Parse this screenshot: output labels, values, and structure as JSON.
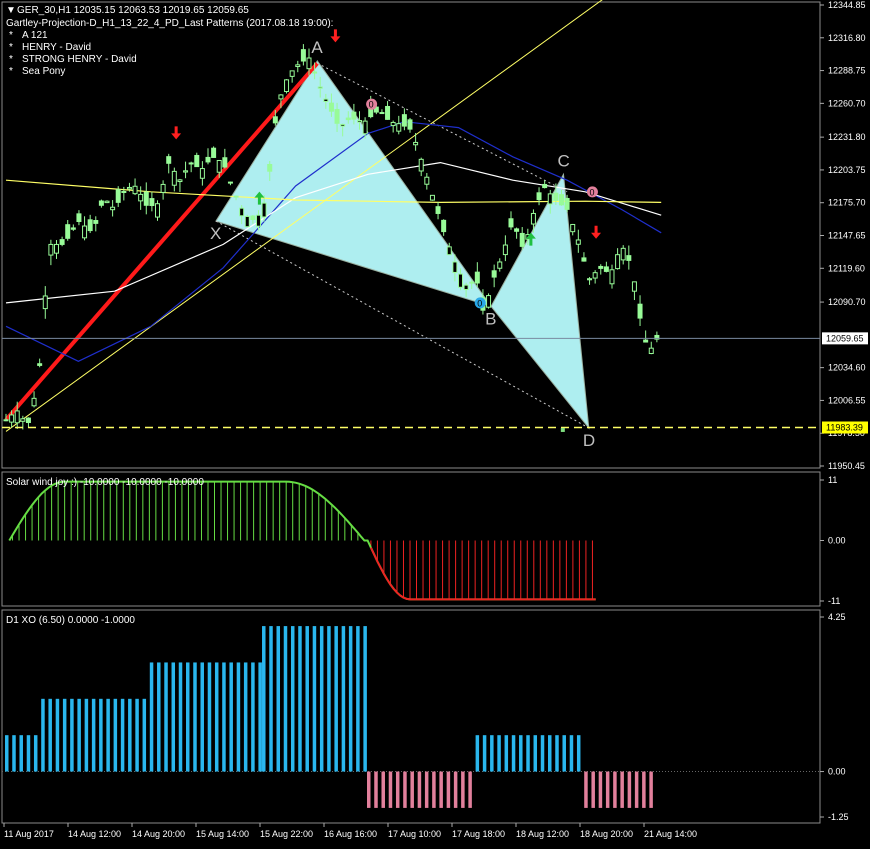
{
  "header": {
    "symbol_line": "GER_30,H1  12035.15 12063.53 12019.65 12059.65",
    "pattern_title": "Gartley-Projection-D_H1_13_22_4_PD_Last Patterns (2017.08.18 19:00):",
    "patterns": [
      "A 121",
      "HENRY - David",
      "STRONG HENRY - David",
      "Sea Pony"
    ],
    "bullet": "*"
  },
  "colors": {
    "background": "#000000",
    "grid": "#3a3a3a",
    "bull_candle": "#98fb98",
    "pattern_fill": "#aeeef0",
    "trend_line": "#ff1a1a",
    "ma_blue": "#1f2fcc",
    "ma_white": "#ffffff",
    "ma_yellow": "#ffff66",
    "solar_positive": "#66dd44",
    "solar_negative": "#ee2222",
    "xo_positive": "#2ab7ee",
    "xo_negative": "#e2809c",
    "current_price_tag": "#ffffff",
    "projection_tag": "#ffff00"
  },
  "chart_data": [
    {
      "type": "candlestick",
      "panel": "main",
      "symbol": "GER_30",
      "timeframe": "H1",
      "ylim": [
        11950.45,
        12344.85
      ],
      "y_ticks": [
        "12344.85",
        "12316.80",
        "12288.75",
        "12260.70",
        "12231.80",
        "12203.75",
        "12175.70",
        "12147.65",
        "12119.60",
        "12090.70",
        "12034.60",
        "12006.55",
        "11978.50",
        "11950.45"
      ],
      "current_price": "12059.65",
      "projection_level": "11983.39",
      "bar_count": 117,
      "close_path": [
        [
          0,
          11990
        ],
        [
          3,
          11998
        ],
        [
          6,
          11985
        ],
        [
          9,
          12025
        ],
        [
          12,
          12140
        ],
        [
          16,
          12140
        ],
        [
          20,
          12160
        ],
        [
          24,
          12150
        ],
        [
          27,
          12180
        ],
        [
          30,
          12170
        ],
        [
          33,
          12188
        ],
        [
          36,
          12190
        ],
        [
          39,
          12172
        ],
        [
          42,
          12175
        ],
        [
          45,
          12210
        ],
        [
          48,
          12195
        ],
        [
          51,
          12210
        ],
        [
          54,
          12204
        ],
        [
          57,
          12215
        ],
        [
          60,
          12210
        ],
        [
          63,
          12185
        ],
        [
          66,
          12165
        ],
        [
          69,
          12160
        ],
        [
          72,
          12180
        ],
        [
          75,
          12260
        ],
        [
          78,
          12285
        ],
        [
          81,
          12295
        ],
        [
          84,
          12300
        ],
        [
          86,
          12280
        ],
        [
          89,
          12260
        ],
        [
          92,
          12240
        ],
        [
          95,
          12248
        ],
        [
          99,
          12245
        ],
        [
          103,
          12255
        ],
        [
          106,
          12245
        ],
        [
          109,
          12243
        ],
        [
          112,
          12238
        ],
        [
          115,
          12210
        ],
        [
          118,
          12180
        ],
        [
          121,
          12150
        ],
        [
          124,
          12125
        ],
        [
          127,
          12105
        ],
        [
          130,
          12110
        ],
        [
          132,
          12080
        ],
        [
          134,
          12105
        ],
        [
          137,
          12130
        ],
        [
          140,
          12160
        ],
        [
          143,
          12135
        ],
        [
          146,
          12170
        ],
        [
          149,
          12190
        ],
        [
          151,
          12180
        ],
        [
          153,
          12175
        ],
        [
          155,
          12170
        ],
        [
          158,
          12145
        ],
        [
          161,
          12110
        ],
        [
          164,
          12120
        ],
        [
          167,
          12115
        ],
        [
          170,
          12140
        ],
        [
          173,
          12120
        ],
        [
          176,
          12060
        ],
        [
          178,
          12050
        ],
        [
          181,
          12065
        ]
      ],
      "moving_averages": [
        {
          "color": "#1f2fcc",
          "path": [
            [
              0,
              12070
            ],
            [
              20,
              12040
            ],
            [
              40,
              12070
            ],
            [
              60,
              12120
            ],
            [
              80,
              12190
            ],
            [
              100,
              12235
            ],
            [
              110,
              12245
            ],
            [
              125,
              12240
            ],
            [
              140,
              12215
            ],
            [
              155,
              12195
            ],
            [
              170,
              12170
            ],
            [
              181,
              12150
            ]
          ]
        },
        {
          "color": "#ffffff",
          "path": [
            [
              0,
              12090
            ],
            [
              30,
              12100
            ],
            [
              60,
              12140
            ],
            [
              80,
              12180
            ],
            [
              100,
              12200
            ],
            [
              120,
              12210
            ],
            [
              140,
              12195
            ],
            [
              160,
              12185
            ],
            [
              181,
              12165
            ]
          ]
        },
        {
          "color": "#ffff66",
          "path": [
            [
              0,
              12195
            ],
            [
              40,
              12185
            ],
            [
              80,
              12178
            ],
            [
              120,
              12176
            ],
            [
              160,
              12177
            ],
            [
              181,
              12176
            ]
          ]
        }
      ],
      "trend_lines": [
        {
          "style": "solid-red",
          "from": [
            0,
            11990
          ],
          "to": [
            86,
            12295
          ]
        },
        {
          "style": "solid-yellow",
          "from": [
            0,
            11980
          ],
          "to": [
            165,
            12350
          ]
        },
        {
          "style": "dotted-white",
          "from": [
            58,
            12160
          ],
          "to": [
            161,
            11983
          ]
        },
        {
          "style": "dotted-white",
          "from": [
            86,
            12295
          ],
          "to": [
            155,
            12185
          ]
        }
      ],
      "harmonic_pattern": {
        "points": [
          {
            "label": "X",
            "bar": 58,
            "price": 12160
          },
          {
            "label": "A",
            "bar": 86,
            "price": 12297
          },
          {
            "label": "B",
            "bar": 134,
            "price": 12087
          },
          {
            "label": "C",
            "bar": 154,
            "price": 12200
          },
          {
            "label": "D",
            "bar": 161,
            "price": 11983
          }
        ]
      },
      "signal_arrows": [
        {
          "dir": "down",
          "color": "red",
          "bar": 47,
          "price": 12235
        },
        {
          "dir": "up",
          "color": "green",
          "bar": 70,
          "price": 12180
        },
        {
          "dir": "down",
          "color": "red",
          "bar": 91,
          "price": 12318
        },
        {
          "dir": "up",
          "color": "green",
          "bar": 145,
          "price": 12145
        },
        {
          "dir": "down",
          "color": "red",
          "bar": 163,
          "price": 12150
        }
      ],
      "zero_markers": [
        {
          "bar": 101,
          "price": 12260,
          "color": "pink"
        },
        {
          "bar": 131,
          "price": 12090,
          "color": "cyan"
        },
        {
          "bar": 162,
          "price": 12185,
          "color": "pink"
        }
      ]
    },
    {
      "type": "histogram",
      "panel": "Solar wind joy",
      "title": "Solar wind joy :) -10.0000 -10.0000 -10.0000",
      "ylim": [
        -11,
        11
      ],
      "y_ticks": [
        "11",
        "0.00",
        "-11"
      ],
      "bars": [
        {
          "from": 1,
          "to": 18,
          "shape": "rise",
          "start": 0,
          "end": 10.7
        },
        {
          "from": 19,
          "to": 85,
          "shape": "flat",
          "value": 10.7
        },
        {
          "from": 86,
          "to": 110,
          "shape": "fall_pos",
          "start": 10.7,
          "end": 0
        },
        {
          "from": 111,
          "to": 124,
          "shape": "fall_neg",
          "start": 0,
          "end": -10.7
        },
        {
          "from": 125,
          "to": 181,
          "shape": "flat",
          "value": -10.7
        }
      ]
    },
    {
      "type": "bar",
      "panel": "D1 XO",
      "title": "D1 XO (6.50) 0.0000 -1.0000",
      "ylim": [
        -1.25,
        4.25
      ],
      "y_ticks": [
        "4.25",
        "0.00",
        "-1.25"
      ],
      "segments": [
        {
          "from": 0,
          "to": 9,
          "value": 1
        },
        {
          "from": 10,
          "to": 39,
          "value": 2
        },
        {
          "from": 40,
          "to": 70,
          "value": 3
        },
        {
          "from": 71,
          "to": 99,
          "value": 4
        },
        {
          "from": 100,
          "to": 129,
          "value": -1
        },
        {
          "from": 130,
          "to": 159,
          "value": 1
        },
        {
          "from": 160,
          "to": 179,
          "value": -1
        }
      ]
    }
  ],
  "x_axis": {
    "labels": [
      "11 Aug 2017",
      "14 Aug 12:00",
      "14 Aug 20:00",
      "15 Aug 14:00",
      "15 Aug 22:00",
      "16 Aug 16:00",
      "17 Aug 10:00",
      "17 Aug 18:00",
      "18 Aug 12:00",
      "18 Aug 20:00",
      "21 Aug 14:00"
    ]
  }
}
